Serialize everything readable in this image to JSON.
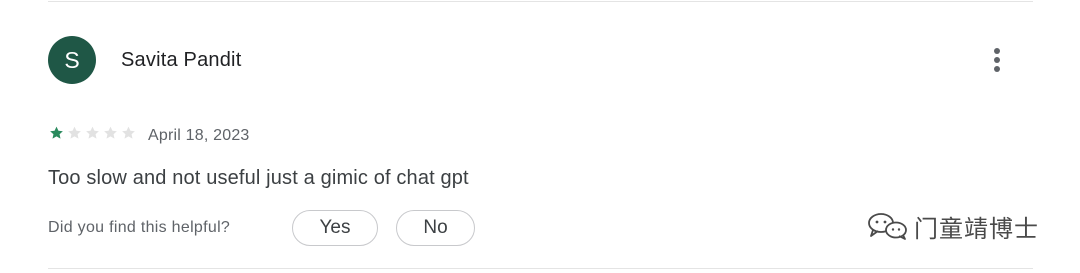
{
  "review": {
    "reviewer": {
      "initial": "S",
      "name": "Savita Pandit",
      "avatar_color": "#1f5746"
    },
    "rating": {
      "value": 1,
      "max": 5,
      "filled_color": "#2a8a5d",
      "empty_color": "#e2e2e2"
    },
    "date": "April 18, 2023",
    "text": "Too slow and not useful just a gimic of chat gpt",
    "helpful": {
      "prompt": "Did you find this helpful?",
      "yes_label": "Yes",
      "no_label": "No"
    },
    "more_menu_icon": "more-vert-icon"
  },
  "watermark": {
    "text": "门童靖博士",
    "icon": "wechat-icon"
  }
}
